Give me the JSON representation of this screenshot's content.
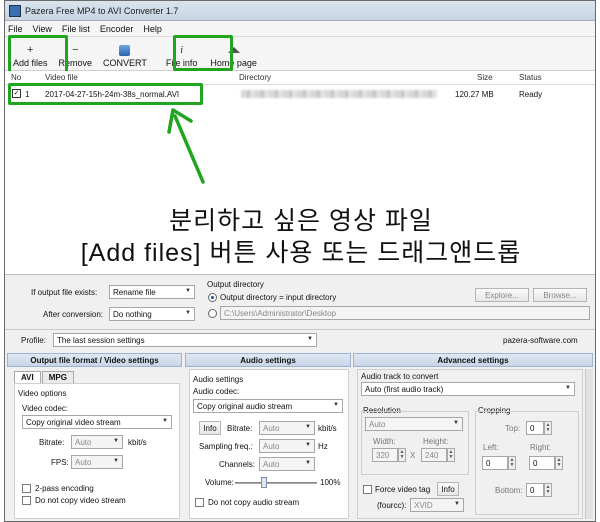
{
  "window": {
    "title": "Pazera Free MP4 to AVI Converter 1.7"
  },
  "menu": [
    "File",
    "View",
    "File list",
    "Encoder",
    "Help"
  ],
  "toolbar": {
    "add_files": "Add files",
    "remove": "Remove",
    "convert": "CONVERT",
    "file_info": "File info",
    "home_page": "Home page",
    "add_icon": "+",
    "remove_icon": "−",
    "info_icon": "i"
  },
  "list": {
    "headers": {
      "no": "No",
      "video_file": "Video file",
      "directory": "Directory",
      "size": "Size",
      "status": "Status"
    },
    "rows": [
      {
        "checked": "✓",
        "no": "1",
        "file": "2017-04-27-15h-24m-38s_normal.AVI",
        "size": "120.27 MB",
        "status": "Ready"
      }
    ]
  },
  "overlay": {
    "line1": "분리하고 싶은 영상 파일",
    "line2": "[Add files] 버튼 사용 또는 드래그앤드롭",
    "accent_color": "#1fa51f"
  },
  "output": {
    "if_exists_label": "If output file exists:",
    "if_exists_value": "Rename file",
    "after_conv_label": "After conversion:",
    "after_conv_value": "Do nothing",
    "dir_title": "Output directory",
    "opt_input_dir": "Output directory = input directory",
    "custom_dir": "C:\\Users\\Administrator\\Desktop",
    "explore": "Explore...",
    "browse": "Browse..."
  },
  "profile": {
    "label": "Profile:",
    "value": "The last session settings",
    "site": "pazera-software.com"
  },
  "video": {
    "header": "Output file format / Video settings",
    "tab_avi": "AVI",
    "tab_mpg": "MPG",
    "options_title": "Video options",
    "codec_label": "Video codec:",
    "codec_value": "Copy original video stream",
    "bitrate_label": "Bitrate:",
    "bitrate_value": "Auto",
    "bitrate_unit": "kbit/s",
    "fps_label": "FPS:",
    "fps_value": "Auto",
    "two_pass": "2-pass encoding",
    "no_copy": "Do not copy video stream"
  },
  "audio": {
    "header": "Audio settings",
    "title": "Audio settings",
    "codec_label": "Audio codec:",
    "codec_value": "Copy original audio stream",
    "info": "Info",
    "bitrate_label": "Bitrate:",
    "bitrate_value": "Auto",
    "bitrate_unit": "kbit/s",
    "freq_label": "Sampling freq.:",
    "freq_value": "Auto",
    "freq_unit": "Hz",
    "channels_label": "Channels:",
    "channels_value": "Auto",
    "volume_label": "Volume:",
    "volume_value": "100%",
    "no_copy": "Do not copy audio stream"
  },
  "advanced": {
    "header": "Advanced settings",
    "track_label": "Audio track to convert",
    "track_value": "Auto (first audio track)",
    "resolution_label": "Resolution",
    "resolution_value": "Auto",
    "width_label": "Width:",
    "width_value": "320",
    "height_label": "Height:",
    "height_value": "240",
    "x_sep": "X",
    "cropping_label": "Cropping",
    "top_label": "Top:",
    "top_value": "0",
    "left_label": "Left:",
    "left_value": "0",
    "right_label": "Right:",
    "right_value": "0",
    "bottom_label": "Bottom:",
    "bottom_value": "0",
    "force_tag": "Force video tag",
    "fourcc_label": "(fourcc):",
    "fourcc_value": "XVID",
    "info": "Info"
  }
}
